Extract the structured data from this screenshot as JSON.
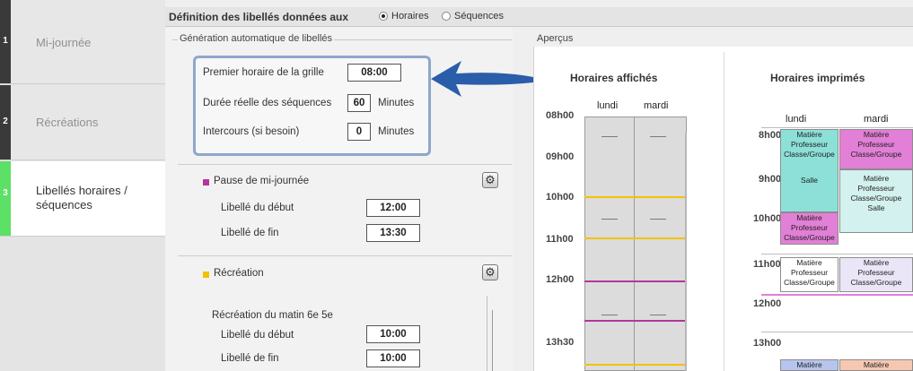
{
  "sidebar": {
    "steps": [
      {
        "num": "1",
        "label": "Mi-journée"
      },
      {
        "num": "2",
        "label": "Récréations"
      },
      {
        "num": "3",
        "label_line1": "Libellés horaires /",
        "label_line2": "séquences"
      }
    ]
  },
  "topbar": {
    "title": "Définition des libellés données aux",
    "radio_horaires": "Horaires",
    "radio_sequences": "Séquences"
  },
  "generation": {
    "title": "Génération automatique de libellés",
    "premier_label": "Premier horaire de la grille",
    "premier_value": "08:00",
    "duree_label": "Durée réelle des séquences",
    "duree_value": "60",
    "duree_unit": "Minutes",
    "intercours_label": "Intercours (si besoin)",
    "intercours_value": "0",
    "intercours_unit": "Minutes"
  },
  "pause": {
    "title": "Pause de mi-journée",
    "debut_label": "Libellé du début",
    "debut_value": "12:00",
    "fin_label": "Libellé de fin",
    "fin_value": "13:30"
  },
  "recreation": {
    "title": "Récréation",
    "sub": "Récréation du matin 6e 5e",
    "debut_label": "Libellé du début",
    "debut_value": "10:00",
    "fin_label": "Libellé de fin",
    "fin_value": "10:00"
  },
  "preview": {
    "title": "Aperçus",
    "affiches_title": "Horaires affichés",
    "imprimes_title": "Horaires imprimés",
    "day1": "lundi",
    "day2": "mardi",
    "times_affiches": [
      "08h00",
      "09h00",
      "10h00",
      "11h00",
      "12h00",
      "13h30"
    ],
    "times_imprimes": [
      "8h00",
      "9h00",
      "10h00",
      "11h00",
      "12h00",
      "13h00"
    ],
    "cell_matiere": "Matière",
    "cell_professeur": "Professeur",
    "cell_classe": "Classe/Groupe",
    "cell_salle": "Salle"
  },
  "colors": {
    "active_step": "#5ce065",
    "pause_marker": "#b4359c",
    "recreation_marker": "#f2c200",
    "arrow": "#2a5daa",
    "cell_teal": "#8de0d8",
    "cell_pink": "#e27fd6",
    "cell_light_pink": "#f3c9ee",
    "cell_light_teal": "#d3f1ee"
  }
}
